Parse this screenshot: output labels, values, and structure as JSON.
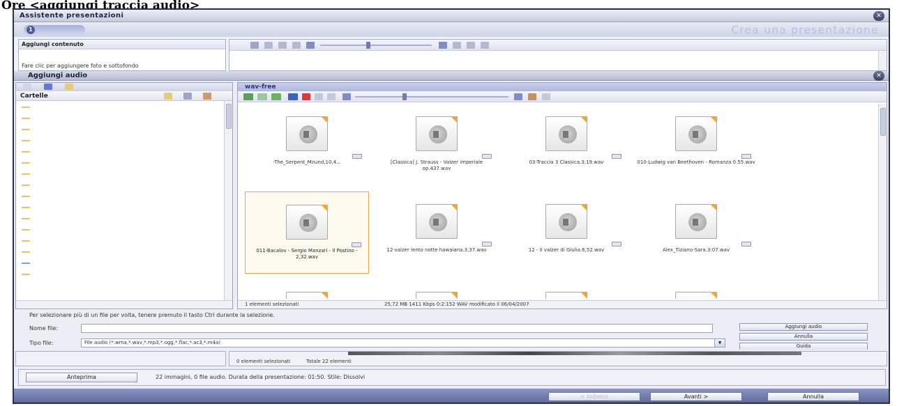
{
  "caption": "Ore <aggiungi traccia audio>",
  "window": {
    "title": "Assistente presentazioni",
    "step_subtitle": "Crea una presentazione"
  },
  "content_panel": {
    "header": "Aggiungi contenuto",
    "hint": "Fare clic per aggiungere foto e sottofondo"
  },
  "dialog": {
    "title": "Aggiungi audio",
    "folder_pane": {
      "header": "Cartelle"
    },
    "path_label": "wav-free",
    "files": [
      {
        "name": "-The_Serpent_Mound,10,4...",
        "selected": false
      },
      {
        "name": "[Classica] J. Strauss - Valzer imperiale op.437.wav",
        "selected": false
      },
      {
        "name": "03-Traccia 3 Classica.3:19.wav",
        "selected": false
      },
      {
        "name": "010-Ludwig van Beethoven - Romanza 0.55.wav",
        "selected": false
      },
      {
        "name": "011-Bacalov - Sergio Manzari - Il Postino - 2,32.wav",
        "selected": true
      },
      {
        "name": "12-valzer lento notte hawaiana.3,37.wav",
        "selected": false
      },
      {
        "name": "12 - Il valzer di Giulia.6,52.wav",
        "selected": false
      },
      {
        "name": "Alex_Tiziano-Sara.3:07.wav",
        "selected": false
      }
    ],
    "files_status": {
      "selected": "1 elementi selezionati",
      "details": "25,72 MB  1411 Kbps 0:2:152 WAV  modificato il 06/04/2007"
    },
    "hint_line": "Per selezionare più di un file per volta, tenere premuto il tasto Ctrl durante la selezione.",
    "nome_file_label": "Nome file:",
    "tipo_file_label": "Tipo file:",
    "tipo_file_value": "File audio (*.wma,*.wav,*.mp3,*.ogg,*.flac,*.ac3,*.m4a)",
    "buttons": {
      "add": "Aggiungi audio",
      "cancel": "Annulla",
      "help": "Guida"
    }
  },
  "lower_status": {
    "selected": "0 elementi selezionati",
    "total": "Totale 22 elementi"
  },
  "preview": {
    "button": "Anteprima",
    "info": "22 immagini, 0 file audio. Durata della presentazione: 01:50. Stile: Dissolvi"
  },
  "footer": {
    "back": "< Indietro",
    "next": "Avanti >",
    "cancel": "Annulla"
  },
  "colors": {
    "titlebar": "#c5c9dc",
    "accent": "#5b6699",
    "selection": "#e5a64a"
  }
}
